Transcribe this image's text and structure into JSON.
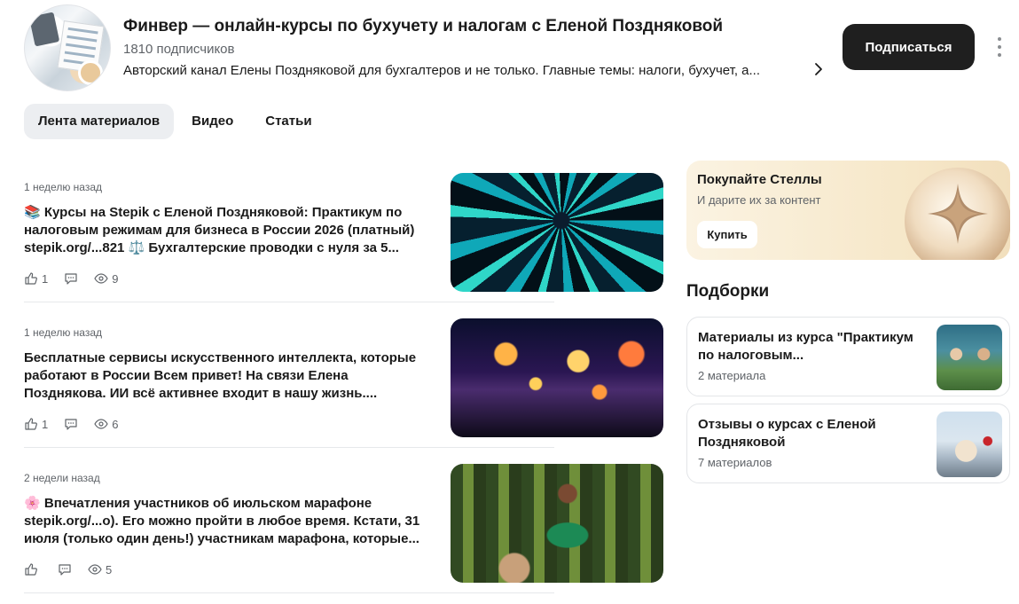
{
  "channel": {
    "title": "Финвер — онлайн-курсы по бухучету и налогам с Еленой Поздняковой",
    "subscribers": "1810 подписчиков",
    "description": "Авторский канал Елены Поздняковой для бухгалтеров и не только. Главные темы: налоги, бухучет, а...",
    "subscribe_label": "Подписаться"
  },
  "tabs": [
    {
      "label": "Лента материалов",
      "active": true
    },
    {
      "label": "Видео",
      "active": false
    },
    {
      "label": "Статьи",
      "active": false
    }
  ],
  "posts": [
    {
      "time": "1 неделю назад",
      "emoji": "📚",
      "text": " Курсы на Stepik с Еленой Поздняковой: Практикум по налоговым режимам для бизнеса в России 2026 (платный) stepik.org/...821 ⚖️ Бухгалтерские проводки с нуля за 5...",
      "likes": "1",
      "views": "9",
      "image_icon": "fractal-spiral-image"
    },
    {
      "time": "1 неделю назад",
      "emoji": "",
      "text": "Бесплатные сервисы искусственного интеллекта, которые работают в России Всем привет! На связи Елена Позднякова. ИИ всё активнее входит в нашу жизнь....",
      "likes": "1",
      "views": "6",
      "image_icon": "glowing-flowers-image"
    },
    {
      "time": "2 недели назад",
      "emoji": "🌸",
      "text": " Впечатления участников об июльском марафоне stepik.org/...o). Его можно пройти в любое время. Кстати, 31 июля (только один день!) участникам марафона, которые...",
      "likes": "",
      "views": "5",
      "image_icon": "woman-in-forest-image"
    }
  ],
  "promo": {
    "title": "Покупайте Стеллы",
    "subtitle": "И дарите их за контент",
    "button": "Купить"
  },
  "collections_title": "Подборки",
  "collections": [
    {
      "title": "Материалы из курса \"Практикум по налоговым...",
      "count": "2 материала"
    },
    {
      "title": "Отзывы о курсах с Еленой Поздняковой",
      "count": "7 материалов"
    }
  ],
  "colors": {
    "accent": "#1f1f1f",
    "muted": "#5f6368",
    "promo_bg": "#f6e7c8"
  }
}
